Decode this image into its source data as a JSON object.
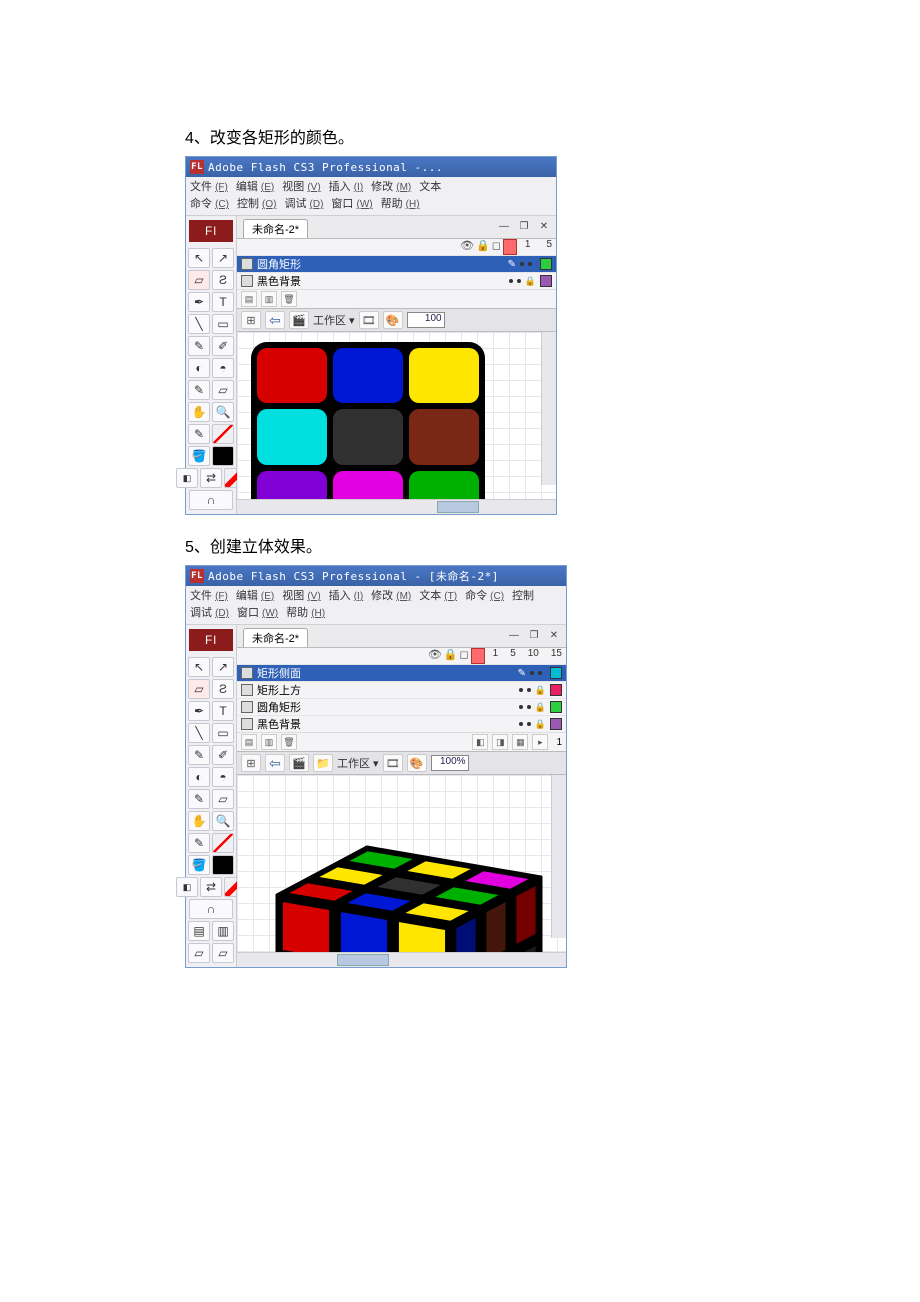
{
  "steps": {
    "s4": "4、改变各矩形的颜色。",
    "s5": "5、创建立体效果。"
  },
  "app": {
    "title1": "Adobe Flash CS3 Professional -...",
    "title2": "Adobe Flash CS3 Professional - [未命名-2*]",
    "logo": "Fl"
  },
  "menus": {
    "row1": [
      {
        "label": "文件",
        "key": "(F)"
      },
      {
        "label": "编辑",
        "key": "(E)"
      },
      {
        "label": "视图",
        "key": "(V)"
      },
      {
        "label": "插入",
        "key": "(I)"
      },
      {
        "label": "修改",
        "key": "(M)"
      },
      {
        "label": "文本",
        "key": ""
      }
    ],
    "row2": [
      {
        "label": "命令",
        "key": "(C)"
      },
      {
        "label": "控制",
        "key": "(O)"
      },
      {
        "label": "调试",
        "key": "(D)"
      },
      {
        "label": "窗口",
        "key": "(W)"
      },
      {
        "label": "帮助",
        "key": "(H)"
      }
    ],
    "b_row1": [
      {
        "label": "文件",
        "key": "(F)"
      },
      {
        "label": "编辑",
        "key": "(E)"
      },
      {
        "label": "视图",
        "key": "(V)"
      },
      {
        "label": "插入",
        "key": "(I)"
      },
      {
        "label": "修改",
        "key": "(M)"
      },
      {
        "label": "文本",
        "key": "(T)"
      },
      {
        "label": "命令",
        "key": "(C)"
      },
      {
        "label": "控制",
        "key": ""
      }
    ],
    "b_row2": [
      {
        "label": "调试",
        "key": "(D)"
      },
      {
        "label": "窗口",
        "key": "(W)"
      },
      {
        "label": "帮助",
        "key": "(H)"
      }
    ]
  },
  "tabs": {
    "doc": "未命名-2*"
  },
  "timeline1": {
    "frame_labels": [
      "1",
      "5"
    ],
    "layers": [
      {
        "name": "圆角矩形",
        "swatch": "#2ecc40",
        "sel": true
      },
      {
        "name": "黑色背景",
        "swatch": "#9b59b6",
        "sel": false
      }
    ]
  },
  "timeline2": {
    "frame_labels": [
      "1",
      "5",
      "10",
      "15"
    ],
    "frame_count": "1",
    "layers": [
      {
        "name": "矩形侧面",
        "swatch": "#00bcd4",
        "sel": true
      },
      {
        "name": "矩形上方",
        "swatch": "#e91e63",
        "sel": false
      },
      {
        "name": "圆角矩形",
        "swatch": "#2ecc40",
        "sel": false
      },
      {
        "name": "黑色背景",
        "swatch": "#9b59b6",
        "sel": false
      }
    ]
  },
  "editbar": {
    "workarea": "工作区 ▾",
    "zoom1": "100",
    "zoom2": "100%"
  },
  "cube2d_colors": [
    [
      "#d60000",
      "#0018d6",
      "#ffe600"
    ],
    [
      "#00e0e0",
      "#303030",
      "#7a2815"
    ],
    [
      "#8000d6",
      "#e000e0",
      "#00b000"
    ]
  ],
  "cube3d": {
    "top": [
      [
        "#00b000",
        "#ffe600",
        "#e000e0"
      ],
      [
        "#ffe600",
        "#303030",
        "#00b000"
      ],
      [
        "#d60000",
        "#0018d6",
        "#ffe600"
      ]
    ],
    "front": [
      [
        "#d60000",
        "#0018d6",
        "#ffe600"
      ],
      [
        "#00e0e0",
        "#303030",
        "#7a2815"
      ],
      [
        "#8000d6",
        "#e000e0",
        "#00b000"
      ]
    ],
    "side": [
      [
        "#0018d6",
        "#7a2815",
        "#d60000"
      ],
      [
        "#00e0e0",
        "#8000d6",
        "#303030"
      ],
      [
        "#e000e0",
        "#0018d6",
        "#303030"
      ]
    ]
  }
}
